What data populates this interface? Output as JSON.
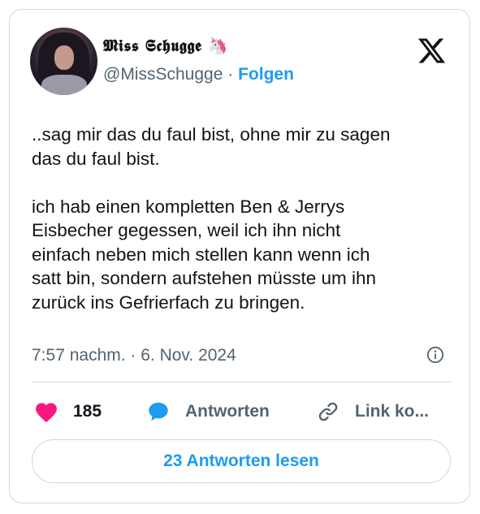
{
  "author": {
    "display_name": "𝕸𝖎𝖘𝖘 𝕾𝖈𝖍𝖚𝖌𝖌𝖊 🦄",
    "handle": "@MissSchugge",
    "separator": "·",
    "follow_label": "Folgen"
  },
  "tweet": {
    "text": "..sag mir das du faul bist, ohne mir zu sagen\ndas du faul bist.\n\nich hab einen kompletten Ben & Jerrys\nEisbecher gegessen, weil ich ihn nicht\neinfach neben mich stellen kann wenn ich\nsatt bin, sondern aufstehen müsste um ihn\nzurück ins Gefrierfach zu bringen.",
    "timestamp": "7:57 nachm. · 6. Nov. 2024"
  },
  "actions": {
    "like_count": "185",
    "reply_label": "Antworten",
    "link_label": "Link ko..."
  },
  "read_replies_label": "23 Antworten lesen",
  "colors": {
    "accent": "#1d9bf0",
    "like": "#f91880",
    "text_secondary": "#536471"
  }
}
